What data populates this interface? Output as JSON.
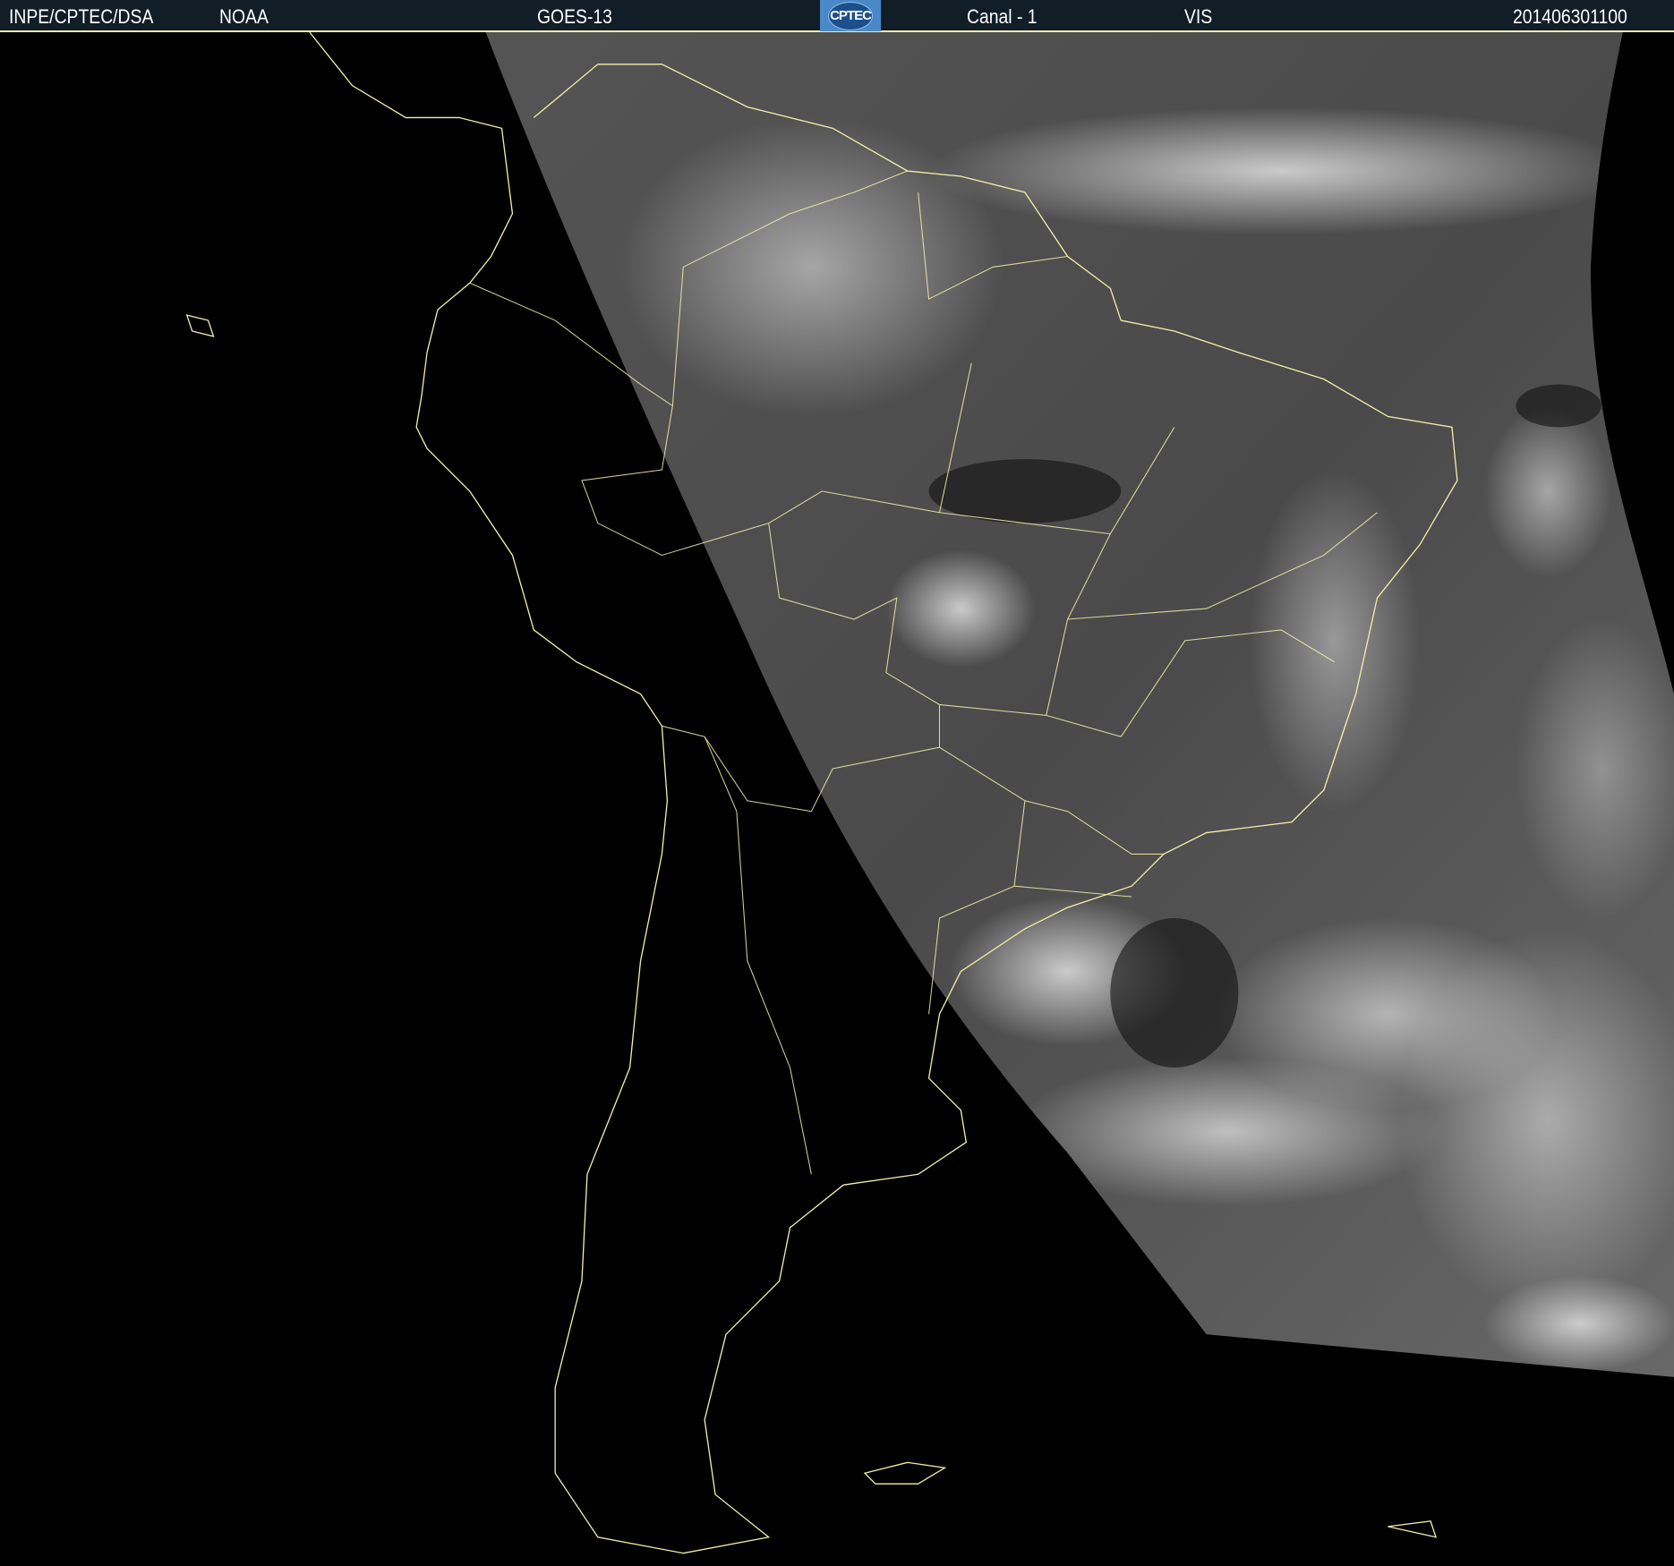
{
  "header": {
    "source": "INPE/CPTEC/DSA",
    "agency": "NOAA",
    "satellite": "GOES-13",
    "logo": "CPTEC",
    "channel": "Canal - 1",
    "band": "VIS",
    "timestamp": "201406301100"
  },
  "colors": {
    "header_bg": "#111d27",
    "coastline": "#f3f0a8",
    "background": "#000000"
  }
}
